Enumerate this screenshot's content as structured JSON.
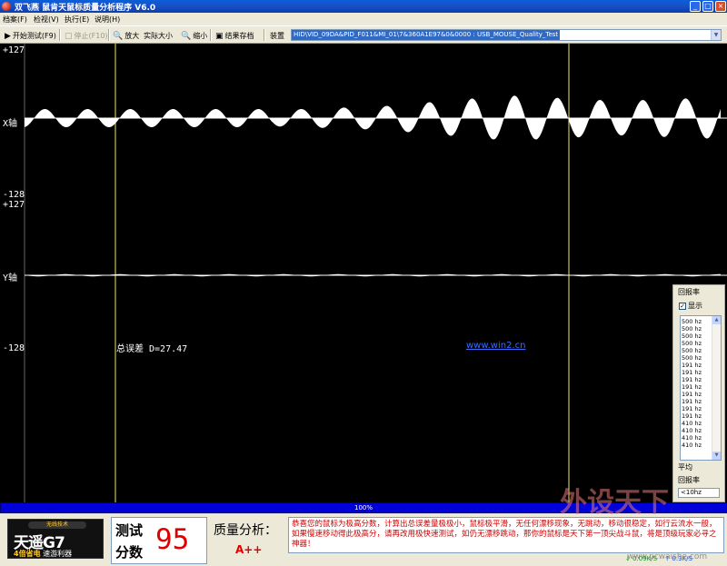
{
  "window": {
    "title": "双飞燕  鼠肯天鼠标质量分析程序  V6.0",
    "controls": [
      "minimize",
      "maximize",
      "close"
    ]
  },
  "menu": [
    {
      "label": "档案(F)"
    },
    {
      "label": "检视(V)"
    },
    {
      "label": "执行(E)"
    },
    {
      "label": "说明(H)"
    }
  ],
  "toolbar": {
    "start_label": "开始测试(F9)",
    "stop_label": "停止(F10)",
    "zoom_in_label": "放大",
    "actual_size_label": "实际大小",
    "zoom_out_label": "缩小",
    "save_result_label": "结果存档",
    "device_label": "装置",
    "device_value": "HID\\VID_09DA&PID_F011&MI_01\\7&360A1E97&0&0000 : USB_MOUSE_Quality_Test"
  },
  "plot": {
    "x_max_label": "+127",
    "x_min_label": "-128",
    "x_axis_label": "X轴",
    "y_max_label": "+127",
    "y_min_label": "-128",
    "y_axis_label": "Y轴",
    "total_error_text": "总误差 D=27.47",
    "link_text": "www.win2.cn",
    "colors": {
      "background": "#000000",
      "signal": "#ffffff",
      "marker": "#e8e86a",
      "link": "#3a6bff"
    }
  },
  "rate_panel": {
    "title": "回报率",
    "show_label": "显示",
    "show_checked": true,
    "rates": [
      "500 hz",
      "500 hz",
      "500 hz",
      "500 hz",
      "500 hz",
      "500 hz",
      "191 hz",
      "191 hz",
      "191 hz",
      "191 hz",
      "191 hz",
      "191 hz",
      "191 hz",
      "191 hz",
      "410 hz",
      "410 hz",
      "410 hz",
      "410 hz"
    ],
    "average_label": "平均",
    "average_label2": "回报率",
    "average_value": "<10hz"
  },
  "progress": {
    "text": "100%",
    "value": 1.0,
    "color": "#0000d8"
  },
  "ad": {
    "top_text": "无线技术",
    "brand": "天遥G7",
    "sub_yellow": "4倍省电",
    "sub_white": "速游利器"
  },
  "score": {
    "label1": "测试",
    "label2": "分数",
    "value": "95"
  },
  "quality": {
    "label": "质量分析：",
    "grade": "A++",
    "message": "恭喜您的鼠标为极高分数，计算出总误差量极极小，鼠标极平滑，无任何漂移现象，无跳动，移动很稳定，如行云流水一般，如果慢速移动得此极高分，请再改用极快速测试，如仍无漂移跳动，那你的鼠标是天下第一顶尖战斗鼠，将是顶级玩家必寻之神器！"
  },
  "status": {
    "download": "0.09K/S",
    "upload": "0.3K/S"
  },
  "watermark": {
    "big": "外设天下",
    "small": "www.pcwaishe.com"
  }
}
